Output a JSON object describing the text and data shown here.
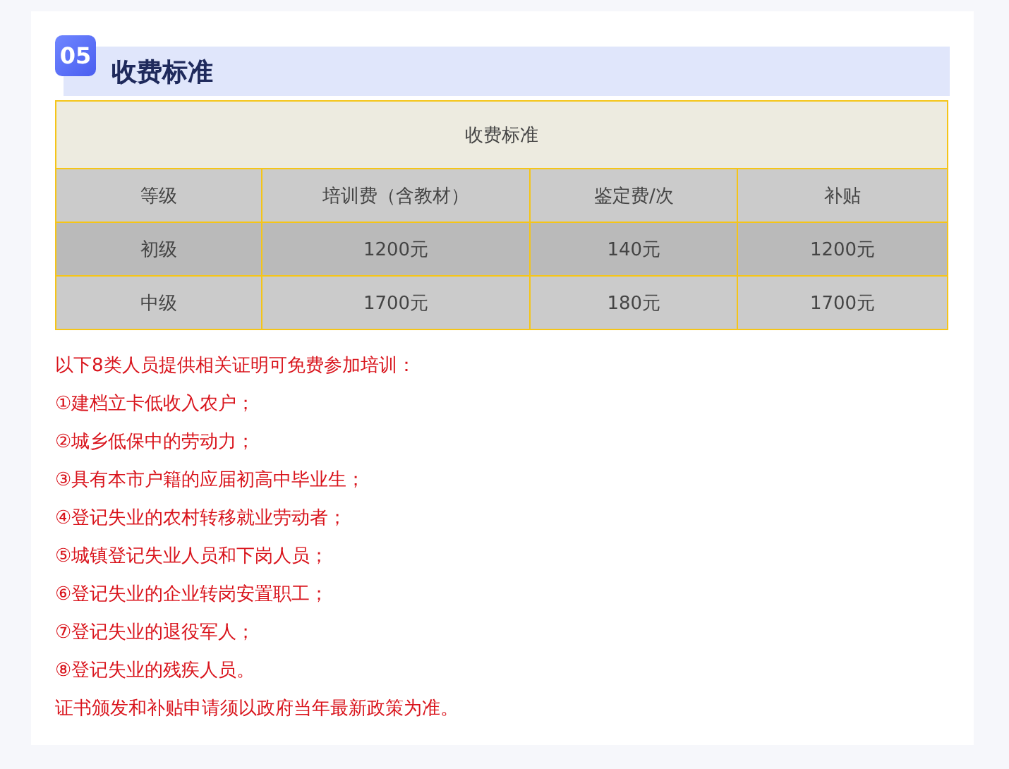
{
  "section": {
    "number": "05",
    "title": "收费标准"
  },
  "table": {
    "caption": "收费标准",
    "columns": [
      "等级",
      "培训费（含教材）",
      "鉴定费/次",
      "补贴"
    ],
    "rows": [
      [
        "初级",
        "1200元",
        "140元",
        "1200元"
      ],
      [
        "中级",
        "1700元",
        "180元",
        "1700元"
      ]
    ]
  },
  "notes": [
    "以下8类人员提供相关证明可免费参加培训：",
    "①建档立卡低收入农户；",
    "②城乡低保中的劳动力；",
    "③具有本市户籍的应届初高中毕业生；",
    "④登记失业的农村转移就业劳动者；",
    "⑤城镇登记失业人员和下岗人员；",
    "⑥登记失业的企业转岗安置职工；",
    "⑦登记失业的退役军人；",
    "⑧登记失业的残疾人员。",
    "证书颁发和补贴申请须以政府当年最新政策为准。"
  ]
}
